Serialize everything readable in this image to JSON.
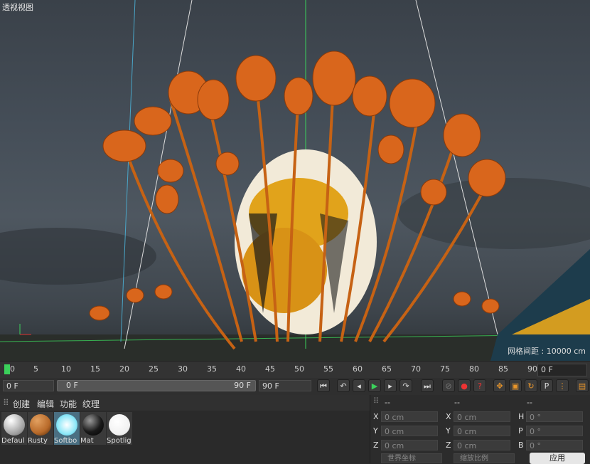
{
  "viewport": {
    "title": "透视视图",
    "grid_spacing": "网格间距 : 10000 cm"
  },
  "timeline": {
    "ticks": [
      "0",
      "5",
      "10",
      "15",
      "20",
      "25",
      "30",
      "35",
      "40",
      "45",
      "50",
      "55",
      "60",
      "65",
      "70",
      "75",
      "80",
      "85",
      "90"
    ],
    "current_frame": "0 F"
  },
  "transport": {
    "start": "0 F",
    "range_start": "0 F",
    "range_end": "90 F",
    "end": "90 F"
  },
  "materials_menu": {
    "items": [
      "创建",
      "编辑",
      "功能",
      "纹理"
    ]
  },
  "materials": [
    {
      "label": "Defaul",
      "color": "#e8e8e8"
    },
    {
      "label": "Rusty",
      "color": "#b86a2a"
    },
    {
      "label": "Softbo",
      "color": "#8fe8f8"
    },
    {
      "label": "Mat",
      "color": "#1a1a1a"
    },
    {
      "label": "Spotlig",
      "color": "#f8f8f8"
    }
  ],
  "coords": {
    "headers": [
      "--",
      "--",
      "--"
    ],
    "rows": [
      {
        "a_label": "X",
        "a_val": "0 cm",
        "b_label": "X",
        "b_val": "0 cm",
        "c_label": "H",
        "c_val": "0 °"
      },
      {
        "a_label": "Y",
        "a_val": "0 cm",
        "b_label": "Y",
        "b_val": "0 cm",
        "c_label": "P",
        "c_val": "0 °"
      },
      {
        "a_label": "Z",
        "a_val": "0 cm",
        "b_label": "Z",
        "b_val": "0 cm",
        "c_label": "B",
        "c_val": "0 °"
      }
    ],
    "world_coords": "世界坐标",
    "scale_ratio": "缩放比例",
    "apply": "应用"
  },
  "colors": {
    "accent": "#3bd15b",
    "flower": "#d9661c"
  }
}
